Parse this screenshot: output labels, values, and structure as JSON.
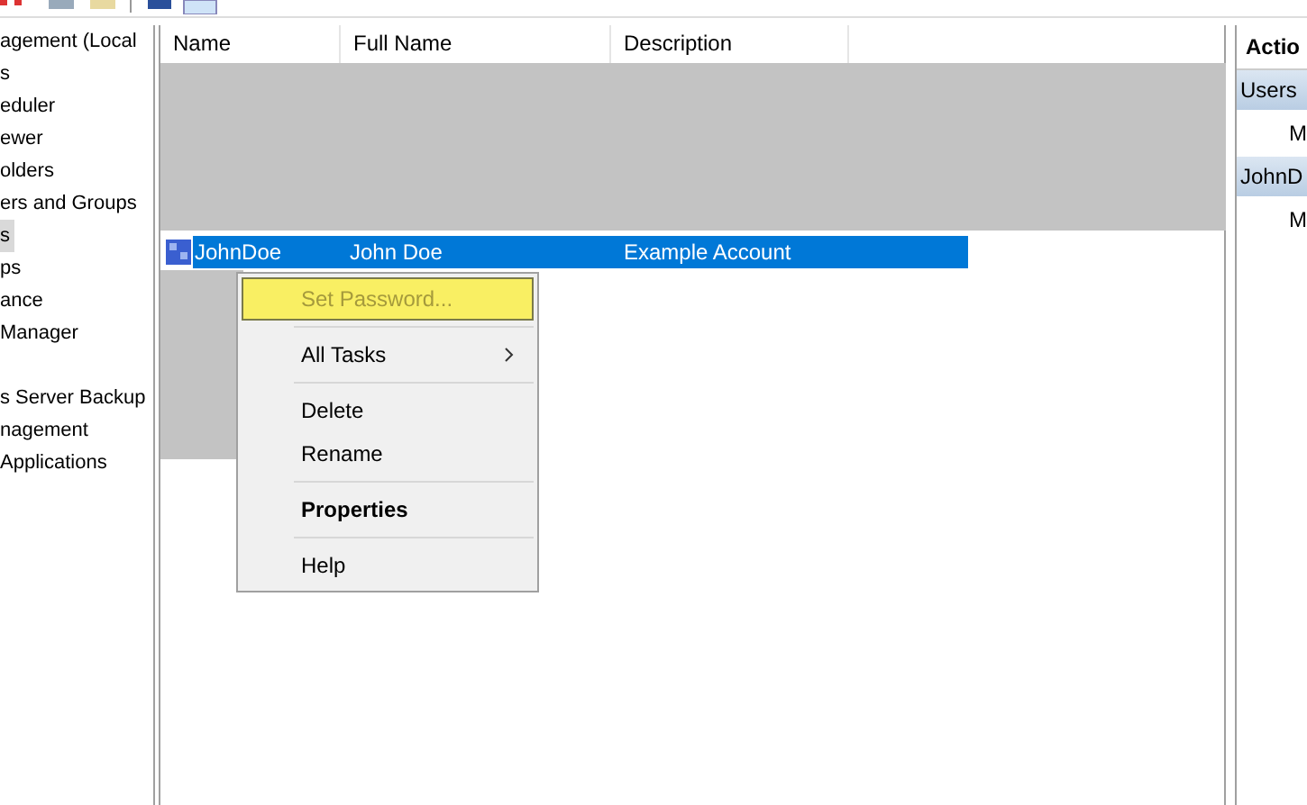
{
  "tree": {
    "items": [
      {
        "kind": "item",
        "label": "agement (Local",
        "selected": false
      },
      {
        "kind": "item",
        "label": "s",
        "selected": false
      },
      {
        "kind": "item",
        "label": "eduler",
        "selected": false
      },
      {
        "kind": "item",
        "label": "ewer",
        "selected": false
      },
      {
        "kind": "item",
        "label": "olders",
        "selected": false
      },
      {
        "kind": "item",
        "label": "ers and Groups",
        "selected": false
      },
      {
        "kind": "item",
        "label": "s",
        "selected": true
      },
      {
        "kind": "item",
        "label": "ps",
        "selected": false
      },
      {
        "kind": "item",
        "label": "ance",
        "selected": false
      },
      {
        "kind": "item",
        "label": "Manager",
        "selected": false
      },
      {
        "kind": "blank"
      },
      {
        "kind": "item",
        "label": "s Server Backup",
        "selected": false
      },
      {
        "kind": "item",
        "label": "nagement",
        "selected": false
      },
      {
        "kind": "item",
        "label": "Applications",
        "selected": false
      }
    ]
  },
  "list": {
    "columns": [
      "Name",
      "Full Name",
      "Description"
    ],
    "rows": [
      {
        "name": "JohnDoe",
        "full_name": "John Doe",
        "description": "Example Account",
        "selected": true
      }
    ]
  },
  "context_menu": {
    "items": [
      {
        "kind": "item",
        "label": "Set Password...",
        "selected": true,
        "disabled": true,
        "bold": false,
        "submenu": false
      },
      {
        "kind": "separator"
      },
      {
        "kind": "item",
        "label": "All Tasks",
        "selected": false,
        "disabled": false,
        "bold": false,
        "submenu": true
      },
      {
        "kind": "separator"
      },
      {
        "kind": "item",
        "label": "Delete",
        "selected": false,
        "disabled": false,
        "bold": false,
        "submenu": false
      },
      {
        "kind": "item",
        "label": "Rename",
        "selected": false,
        "disabled": false,
        "bold": false,
        "submenu": false
      },
      {
        "kind": "separator"
      },
      {
        "kind": "item",
        "label": "Properties",
        "selected": false,
        "disabled": false,
        "bold": true,
        "submenu": false
      },
      {
        "kind": "separator"
      },
      {
        "kind": "item",
        "label": "Help",
        "selected": false,
        "disabled": false,
        "bold": false,
        "submenu": false
      }
    ]
  },
  "actions": {
    "title": "Actio",
    "sections": [
      {
        "title": "Users",
        "items": [
          "M"
        ]
      },
      {
        "title": "JohnD",
        "items": [
          "M"
        ]
      }
    ]
  }
}
